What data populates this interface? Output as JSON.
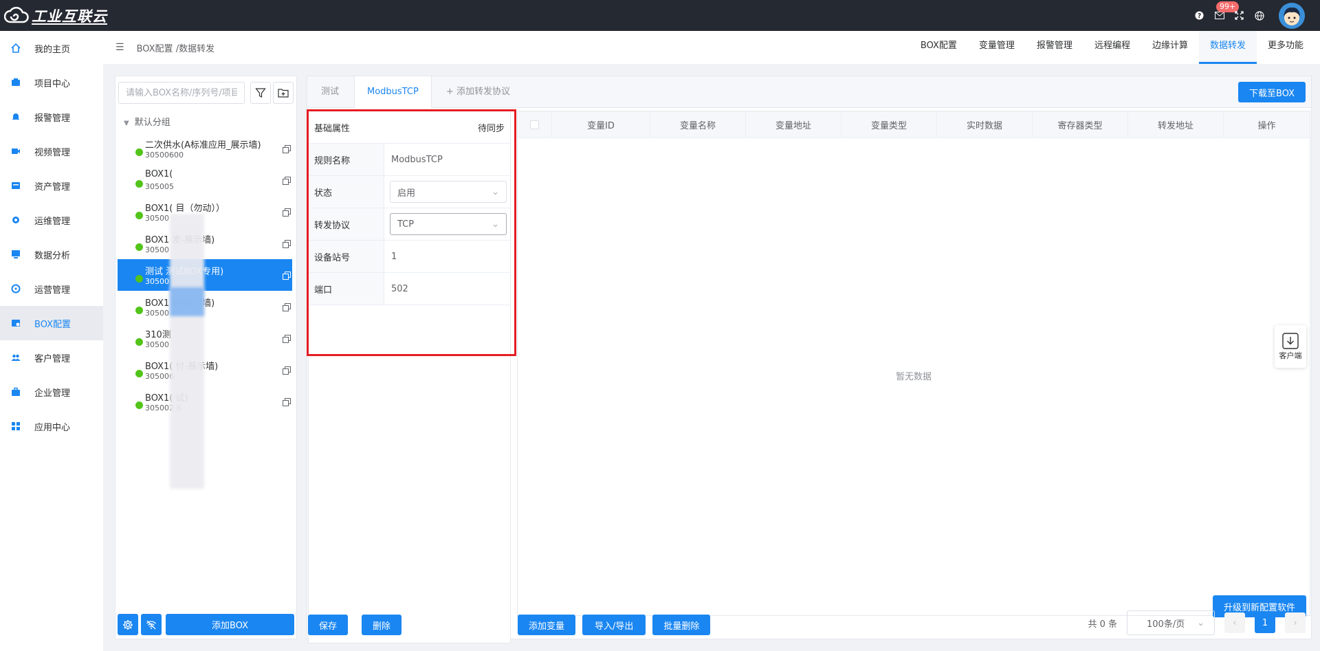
{
  "app": {
    "title": "工业互联云"
  },
  "topbar": {
    "mail_badge": "99+"
  },
  "sidebar": {
    "items": [
      {
        "label": "我的主页",
        "icon": "home-icon"
      },
      {
        "label": "项目中心",
        "icon": "project-icon"
      },
      {
        "label": "报警管理",
        "icon": "bell-icon"
      },
      {
        "label": "视频管理",
        "icon": "video-icon"
      },
      {
        "label": "资产管理",
        "icon": "asset-icon"
      },
      {
        "label": "运维管理",
        "icon": "gear-icon"
      },
      {
        "label": "数据分析",
        "icon": "chart-icon"
      },
      {
        "label": "运营管理",
        "icon": "operation-icon"
      },
      {
        "label": "BOX配置",
        "icon": "box-icon",
        "active": true
      },
      {
        "label": "客户管理",
        "icon": "users-icon"
      },
      {
        "label": "企业管理",
        "icon": "briefcase-icon"
      },
      {
        "label": "应用中心",
        "icon": "apps-icon"
      }
    ]
  },
  "header": {
    "breadcrumb": "BOX配置 /数据转发",
    "tabs": [
      "BOX配置",
      "变量管理",
      "报警管理",
      "远程编程",
      "边缘计算",
      "数据转发",
      "更多功能"
    ],
    "active_tab": "数据转发"
  },
  "left": {
    "search_placeholder": "请输入BOX名称/序列号/项目",
    "group": "默认分组",
    "devices": [
      {
        "name": "二次供水(A标准应用_展示墙)",
        "sn": "30500600"
      },
      {
        "name": "BOX1(",
        "sn": "305005"
      },
      {
        "name": "BOX1(        目（勿动））",
        "sn": "30500"
      },
      {
        "name": "BOX1        发-展示墙)",
        "sn": "30500"
      },
      {
        "name": "测试         测试BOX专用)",
        "sn": "30500"
      },
      {
        "name": "BOX1        联-展示墙)",
        "sn": "30500"
      },
      {
        "name": "310测",
        "sn": "30500"
      },
      {
        "name": "BOX1(        付-展示墙)",
        "sn": "305006"
      },
      {
        "name": "BOX1(        试)",
        "sn": "305002        8"
      }
    ],
    "add_box": "添加BOX"
  },
  "main": {
    "proto_tabs": [
      "测试",
      "ModbusTCP"
    ],
    "active_proto": "ModbusTCP",
    "add_proto": "+ 添加转发协议",
    "download": "下载至BOX",
    "props": {
      "title": "基础属性",
      "sync": "待同步",
      "rows": [
        {
          "k": "规则名称",
          "v": "ModbusTCP"
        },
        {
          "k": "状态",
          "v": "启用"
        },
        {
          "k": "转发协议",
          "v": "TCP"
        },
        {
          "k": "设备站号",
          "v": "1"
        },
        {
          "k": "端口",
          "v": "502"
        }
      ]
    },
    "table": {
      "columns": [
        "变量ID",
        "变量名称",
        "变量地址",
        "变量类型",
        "实时数据",
        "寄存器类型",
        "转发地址",
        "操作"
      ],
      "empty": "暂无数据"
    },
    "upgrade": "升级到新配置软件",
    "buttons": {
      "save": "保存",
      "delete": "删除",
      "add_var": "添加变量",
      "import_export": "导入/导出",
      "batch_delete": "批量删除"
    },
    "pager": {
      "total": "共 0 条",
      "size": "100条/页",
      "page": "1"
    }
  },
  "service": {
    "label": "客户端"
  }
}
